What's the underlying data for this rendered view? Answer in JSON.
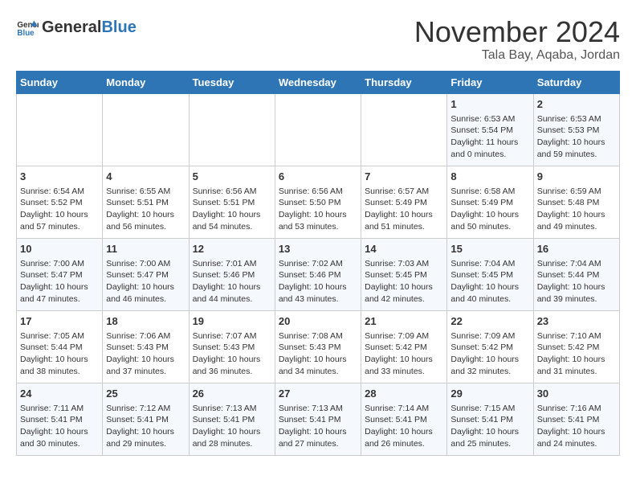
{
  "header": {
    "logo_general": "General",
    "logo_blue": "Blue",
    "month_title": "November 2024",
    "subtitle": "Tala Bay, Aqaba, Jordan"
  },
  "calendar": {
    "columns": [
      "Sunday",
      "Monday",
      "Tuesday",
      "Wednesday",
      "Thursday",
      "Friday",
      "Saturday"
    ],
    "weeks": [
      {
        "days": [
          {
            "num": "",
            "content": ""
          },
          {
            "num": "",
            "content": ""
          },
          {
            "num": "",
            "content": ""
          },
          {
            "num": "",
            "content": ""
          },
          {
            "num": "",
            "content": ""
          },
          {
            "num": "1",
            "content": "Sunrise: 6:53 AM\nSunset: 5:54 PM\nDaylight: 11 hours and 0 minutes."
          },
          {
            "num": "2",
            "content": "Sunrise: 6:53 AM\nSunset: 5:53 PM\nDaylight: 10 hours and 59 minutes."
          }
        ]
      },
      {
        "days": [
          {
            "num": "3",
            "content": "Sunrise: 6:54 AM\nSunset: 5:52 PM\nDaylight: 10 hours and 57 minutes."
          },
          {
            "num": "4",
            "content": "Sunrise: 6:55 AM\nSunset: 5:51 PM\nDaylight: 10 hours and 56 minutes."
          },
          {
            "num": "5",
            "content": "Sunrise: 6:56 AM\nSunset: 5:51 PM\nDaylight: 10 hours and 54 minutes."
          },
          {
            "num": "6",
            "content": "Sunrise: 6:56 AM\nSunset: 5:50 PM\nDaylight: 10 hours and 53 minutes."
          },
          {
            "num": "7",
            "content": "Sunrise: 6:57 AM\nSunset: 5:49 PM\nDaylight: 10 hours and 51 minutes."
          },
          {
            "num": "8",
            "content": "Sunrise: 6:58 AM\nSunset: 5:49 PM\nDaylight: 10 hours and 50 minutes."
          },
          {
            "num": "9",
            "content": "Sunrise: 6:59 AM\nSunset: 5:48 PM\nDaylight: 10 hours and 49 minutes."
          }
        ]
      },
      {
        "days": [
          {
            "num": "10",
            "content": "Sunrise: 7:00 AM\nSunset: 5:47 PM\nDaylight: 10 hours and 47 minutes."
          },
          {
            "num": "11",
            "content": "Sunrise: 7:00 AM\nSunset: 5:47 PM\nDaylight: 10 hours and 46 minutes."
          },
          {
            "num": "12",
            "content": "Sunrise: 7:01 AM\nSunset: 5:46 PM\nDaylight: 10 hours and 44 minutes."
          },
          {
            "num": "13",
            "content": "Sunrise: 7:02 AM\nSunset: 5:46 PM\nDaylight: 10 hours and 43 minutes."
          },
          {
            "num": "14",
            "content": "Sunrise: 7:03 AM\nSunset: 5:45 PM\nDaylight: 10 hours and 42 minutes."
          },
          {
            "num": "15",
            "content": "Sunrise: 7:04 AM\nSunset: 5:45 PM\nDaylight: 10 hours and 40 minutes."
          },
          {
            "num": "16",
            "content": "Sunrise: 7:04 AM\nSunset: 5:44 PM\nDaylight: 10 hours and 39 minutes."
          }
        ]
      },
      {
        "days": [
          {
            "num": "17",
            "content": "Sunrise: 7:05 AM\nSunset: 5:44 PM\nDaylight: 10 hours and 38 minutes."
          },
          {
            "num": "18",
            "content": "Sunrise: 7:06 AM\nSunset: 5:43 PM\nDaylight: 10 hours and 37 minutes."
          },
          {
            "num": "19",
            "content": "Sunrise: 7:07 AM\nSunset: 5:43 PM\nDaylight: 10 hours and 36 minutes."
          },
          {
            "num": "20",
            "content": "Sunrise: 7:08 AM\nSunset: 5:43 PM\nDaylight: 10 hours and 34 minutes."
          },
          {
            "num": "21",
            "content": "Sunrise: 7:09 AM\nSunset: 5:42 PM\nDaylight: 10 hours and 33 minutes."
          },
          {
            "num": "22",
            "content": "Sunrise: 7:09 AM\nSunset: 5:42 PM\nDaylight: 10 hours and 32 minutes."
          },
          {
            "num": "23",
            "content": "Sunrise: 7:10 AM\nSunset: 5:42 PM\nDaylight: 10 hours and 31 minutes."
          }
        ]
      },
      {
        "days": [
          {
            "num": "24",
            "content": "Sunrise: 7:11 AM\nSunset: 5:41 PM\nDaylight: 10 hours and 30 minutes."
          },
          {
            "num": "25",
            "content": "Sunrise: 7:12 AM\nSunset: 5:41 PM\nDaylight: 10 hours and 29 minutes."
          },
          {
            "num": "26",
            "content": "Sunrise: 7:13 AM\nSunset: 5:41 PM\nDaylight: 10 hours and 28 minutes."
          },
          {
            "num": "27",
            "content": "Sunrise: 7:13 AM\nSunset: 5:41 PM\nDaylight: 10 hours and 27 minutes."
          },
          {
            "num": "28",
            "content": "Sunrise: 7:14 AM\nSunset: 5:41 PM\nDaylight: 10 hours and 26 minutes."
          },
          {
            "num": "29",
            "content": "Sunrise: 7:15 AM\nSunset: 5:41 PM\nDaylight: 10 hours and 25 minutes."
          },
          {
            "num": "30",
            "content": "Sunrise: 7:16 AM\nSunset: 5:41 PM\nDaylight: 10 hours and 24 minutes."
          }
        ]
      }
    ]
  }
}
